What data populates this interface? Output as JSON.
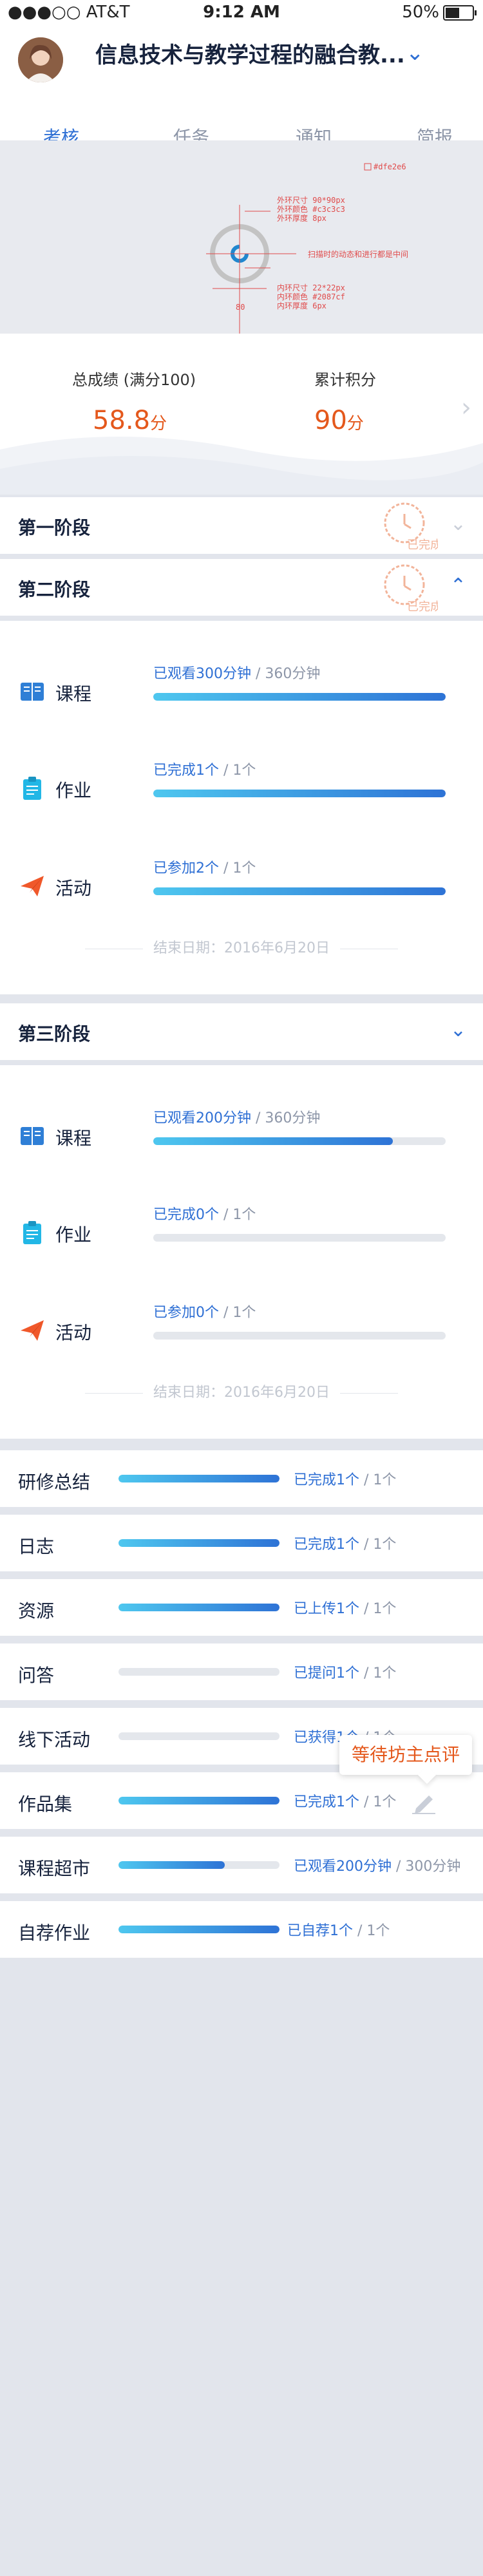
{
  "status_bar": {
    "carrier": "●●●○○ AT&T",
    "time": "9:12 AM",
    "battery": "50%"
  },
  "header": {
    "title": "信息技术与教学过程的融合教...",
    "chevron": "chevron-down-icon"
  },
  "tabs": [
    {
      "label": "考核",
      "active": true
    },
    {
      "label": "任务",
      "active": false
    },
    {
      "label": "通知",
      "active": false
    },
    {
      "label": "简报",
      "active": false
    }
  ],
  "spec_notes": {
    "color_tag": "#dfe2e6",
    "outer_size": "外环尺寸   90*90px",
    "outer_color": "外环颜色   #c3c3c3",
    "outer_thick": "外环厚度   8px",
    "center_note": "扫描时的动态和进行都是中间",
    "inner_size": "内环尺寸   22*22px",
    "inner_color": "内环颜色   #2087cf",
    "inner_thick": "内环厚度   6px",
    "dim_label": "80"
  },
  "score": {
    "total_label": "总成绩 (满分100)",
    "total_value": "58.8",
    "total_unit": "分",
    "points_label": "累计积分",
    "points_value": "90",
    "points_unit": "分"
  },
  "stamp_text": "已完成",
  "stages": {
    "stage1": {
      "title": "第一阶段"
    },
    "stage2": {
      "title": "第二阶段",
      "rows": [
        {
          "label": "课程",
          "status": "已观看300分钟",
          "total": " / 360分钟",
          "progress": 1.0
        },
        {
          "label": "作业",
          "status": "已完成1个",
          "total": " / 1个",
          "progress": 1.0
        },
        {
          "label": "活动",
          "status": "已参加2个",
          "total": " / 1个",
          "progress": 1.0
        }
      ],
      "end_date": "结束日期：2016年6月20日"
    },
    "stage3": {
      "title": "第三阶段",
      "rows": [
        {
          "label": "课程",
          "status": "已观看200分钟",
          "total": " / 360分钟",
          "progress": 0.82
        },
        {
          "label": "作业",
          "status": "已完成0个",
          "total": " / 1个",
          "progress": 0
        },
        {
          "label": "活动",
          "status": "已参加0个",
          "total": " / 1个",
          "progress": 0
        }
      ],
      "end_date": "结束日期：2016年6月20日"
    }
  },
  "summary": [
    {
      "label": "研修总结",
      "status": "已完成1个",
      "total": " / 1个",
      "progress": 1.0
    },
    {
      "label": "日志",
      "status": "已完成1个",
      "total": " / 1个",
      "progress": 1.0
    },
    {
      "label": "资源",
      "status": "已上传1个",
      "total": " / 1个",
      "progress": 1.0
    },
    {
      "label": "问答",
      "status": "已提问1个",
      "total": " / 1个",
      "progress": 0
    },
    {
      "label": "线下活动",
      "status": "已获得1个",
      "total": " / 1个",
      "progress": 0
    },
    {
      "label": "作品集",
      "status": "已完成1个",
      "total": " / 1个",
      "progress": 1.0
    },
    {
      "label": "课程超市",
      "status": "已观看200分钟",
      "total": " / 300分钟",
      "progress": 0.66
    },
    {
      "label": "自荐作业",
      "status": "已自荐1个",
      "total": " / 1个",
      "progress": 1.0
    }
  ],
  "tooltip": "等待坊主点评",
  "colors": {
    "accent": "#2e6fd4",
    "score": "#e4581c",
    "stamp": "#f2b49a"
  }
}
